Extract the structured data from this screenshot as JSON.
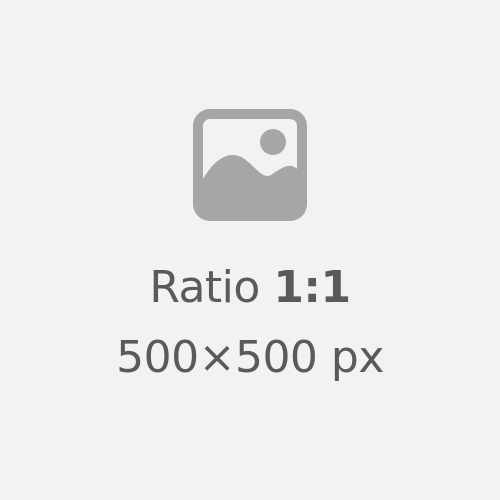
{
  "placeholder": {
    "icon": "image-icon",
    "ratio_label": "Ratio",
    "ratio_value": "1:1",
    "size_text": "500×500 px"
  },
  "colors": {
    "background": "#f1f2f4",
    "icon": "#a6a6a6",
    "text": "#5a5a5a"
  }
}
